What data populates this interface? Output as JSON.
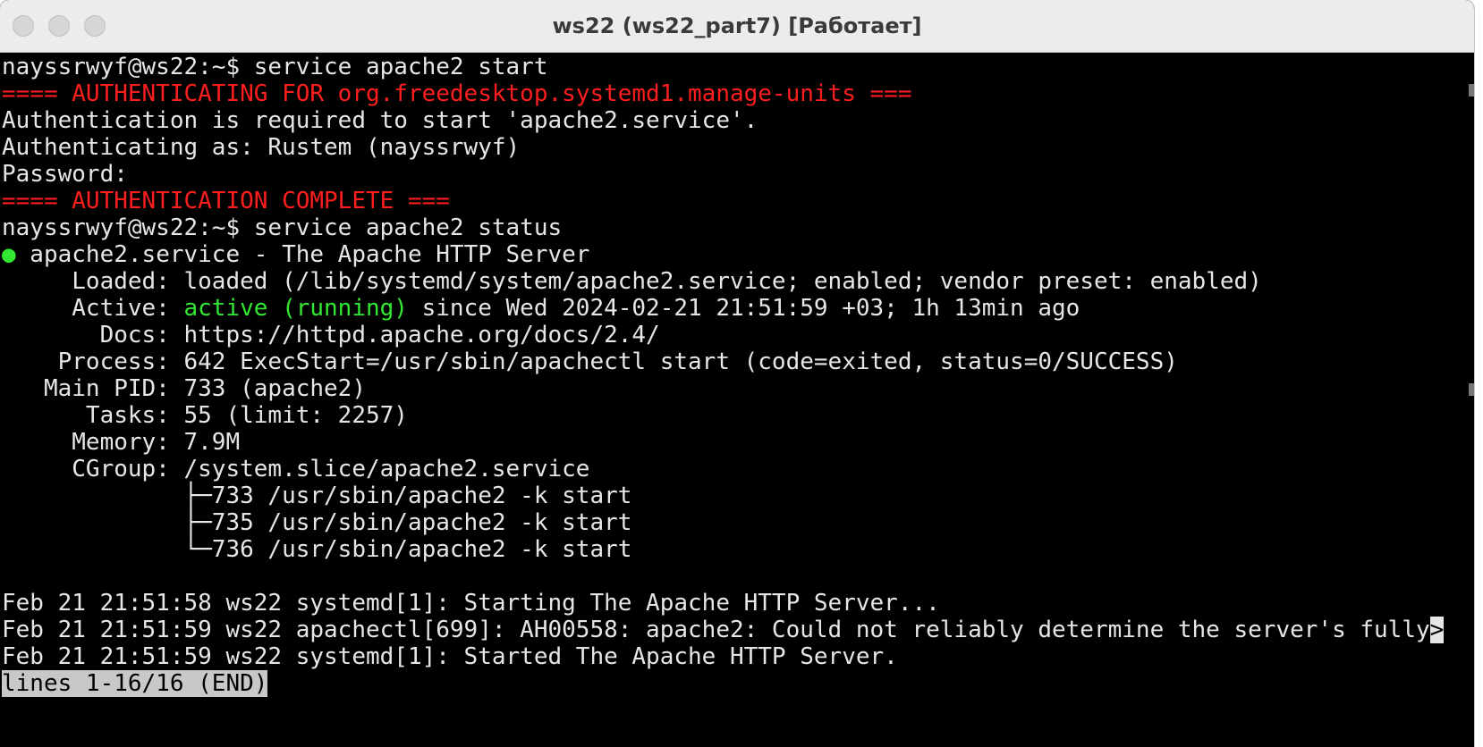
{
  "window": {
    "title": "ws22 (ws22_part7) [Работает]"
  },
  "terminal": {
    "lines": {
      "l1": "nayssrwyf@ws22:~$ service apache2 start",
      "l2": "==== AUTHENTICATING FOR org.freedesktop.systemd1.manage-units ===",
      "l3": "Authentication is required to start 'apache2.service'.",
      "l4": "Authenticating as: Rustem (nayssrwyf)",
      "l5": "Password:",
      "l6": "==== AUTHENTICATION COMPLETE ===",
      "l7": "nayssrwyf@ws22:~$ service apache2 status",
      "l8_bullet": "●",
      "l8_text": " apache2.service - The Apache HTTP Server",
      "l9": "     Loaded: loaded (/lib/systemd/system/apache2.service; enabled; vendor preset: enabled)",
      "l10_pre": "     Active: ",
      "l10_status": "active (running)",
      "l10_post": " since Wed 2024-02-21 21:51:59 +03; 1h 13min ago",
      "l11": "       Docs: https://httpd.apache.org/docs/2.4/",
      "l12": "    Process: 642 ExecStart=/usr/sbin/apachectl start (code=exited, status=0/SUCCESS)",
      "l13": "   Main PID: 733 (apache2)",
      "l14": "      Tasks: 55 (limit: 2257)",
      "l15": "     Memory: 7.9M",
      "l16": "     CGroup: /system.slice/apache2.service",
      "l17": "             ├─733 /usr/sbin/apache2 -k start",
      "l18": "             ├─735 /usr/sbin/apache2 -k start",
      "l19": "             └─736 /usr/sbin/apache2 -k start",
      "l20": "Feb 21 21:51:58 ws22 systemd[1]: Starting The Apache HTTP Server...",
      "l21": "Feb 21 21:51:59 ws22 apachectl[699]: AH00558: apache2: Could not reliably determine the server's fully",
      "l21_marker": ">",
      "l22": "Feb 21 21:51:59 ws22 systemd[1]: Started The Apache HTTP Server.",
      "pager": "lines 1-16/16 (END)"
    }
  },
  "colors": {
    "error_red": "#ff1e1e",
    "status_green": "#33e833",
    "terminal_bg": "#000000",
    "terminal_fg": "#e6e6e6"
  }
}
